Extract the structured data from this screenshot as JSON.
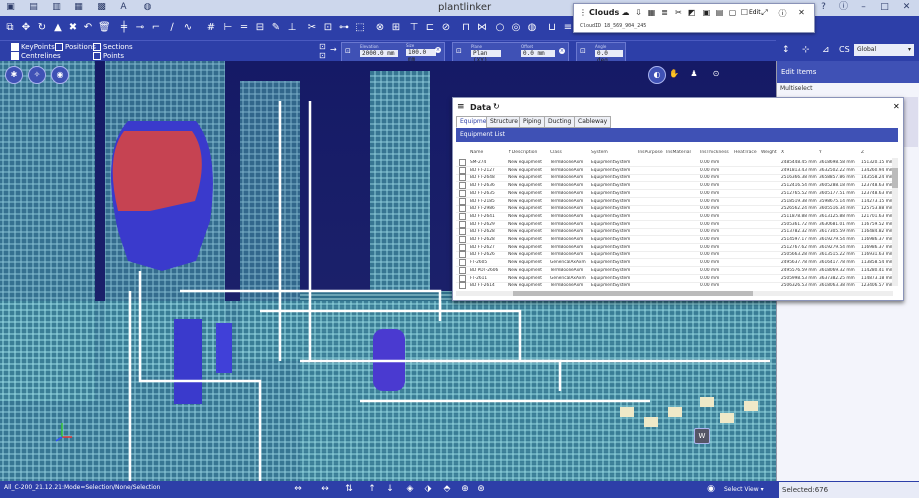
{
  "app": {
    "title": "plantlinker"
  },
  "toggles": [
    {
      "label": "KeyPoints",
      "checked": true
    },
    {
      "label": "Centrelines",
      "checked": true
    },
    {
      "label": "Positions",
      "checked": false
    },
    {
      "label": "Sections",
      "checked": false
    },
    {
      "label": "Points",
      "checked": false
    }
  ],
  "params": [
    {
      "label": "Elevation",
      "value": "2000.0 mm"
    },
    {
      "label": "Size",
      "value": "100.0 mm"
    },
    {
      "label": "Plane",
      "value": "Plan (XY)"
    },
    {
      "label": "Offset",
      "value": "0.0 mm"
    },
    {
      "label": "Angle",
      "value": "0.0 deg"
    }
  ],
  "right_toolbar": {
    "coord_system": "Global"
  },
  "edit_panel": {
    "title": "Edit Items",
    "mode": "Multiselect"
  },
  "clouds": {
    "title": "Clouds",
    "edit_label": "Edit",
    "cloud_id": "CloudID  18_569_904_245"
  },
  "data_window": {
    "title": "Data",
    "tabs": [
      "Equipment",
      "Structure",
      "Piping",
      "Ducting",
      "Cableway"
    ],
    "list_title": "Equipment List",
    "columns": [
      "Name",
      "Description",
      "Class",
      "System",
      "InsPurpose",
      "InsMaterial",
      "InsThickness",
      "HeatTrace",
      "Weight",
      "X",
      "Y",
      "Z"
    ],
    "rows": [
      [
        "SM-274",
        "New equipment",
        "TermBoolieAxm",
        "EquipmentSystem",
        "",
        "",
        "0.00 mm",
        "",
        "",
        "2485448.45 mm",
        "3618698.58 mm",
        "151320.15 mm"
      ],
      [
        "BD FT-2127",
        "New equipment",
        "TermBoolieAxm",
        "EquipmentSystem",
        "",
        "",
        "0.00 mm",
        "",
        "",
        "2491813.43 mm",
        "3632502.22 mm",
        "134260.94 mm"
      ],
      [
        "BD FT-2648",
        "New equipment",
        "TermBoolieAxm",
        "EquipmentSystem",
        "",
        "",
        "0.00 mm",
        "",
        "",
        "2516366.38 mm",
        "3658857.86 mm",
        "143558.24 mm"
      ],
      [
        "BD FT-2636",
        "New equipment",
        "TermBoolieAxm",
        "EquipmentSystem",
        "",
        "",
        "0.00 mm",
        "",
        "",
        "2512416.54 mm",
        "3605288.18 mm",
        "123748.63 mm"
      ],
      [
        "BD FT-2635",
        "New equipment",
        "TermBoolieAxm",
        "EquipmentSystem",
        "",
        "",
        "0.00 mm",
        "",
        "",
        "2512765.52 mm",
        "3605177.51 mm",
        "123748.63 mm"
      ],
      [
        "BD FT-2185",
        "New equipment",
        "TermBoolieAxm",
        "EquipmentSystem",
        "",
        "",
        "0.00 mm",
        "",
        "",
        "2518519.38 mm",
        "3598675.14 mm",
        "114273.15 mm"
      ],
      [
        "BD FT-2986",
        "New equipment",
        "TermBoolieAxm",
        "EquipmentSystem",
        "",
        "",
        "0.00 mm",
        "",
        "",
        "2526562.24 mm",
        "3605516.34 mm",
        "125753.88 mm"
      ],
      [
        "BD FT-2641",
        "New equipment",
        "TermBoolieAxm",
        "EquipmentSystem",
        "",
        "",
        "0.00 mm",
        "",
        "",
        "2511878.88 mm",
        "3613125.88 mm",
        "121701.63 mm"
      ],
      [
        "BD FT-2629",
        "New equipment",
        "TermBoolieAxm",
        "EquipmentSystem",
        "",
        "",
        "0.00 mm",
        "",
        "",
        "2505361.72 mm",
        "3630681.01 mm",
        "116759.52 mm"
      ],
      [
        "BD FT-2628",
        "New equipment",
        "TermBoolieAxm",
        "EquipmentSystem",
        "",
        "",
        "0.00 mm",
        "",
        "",
        "2513782.32 mm",
        "3617305.59 mm",
        "116484.82 mm"
      ],
      [
        "BD FT-2628",
        "New equipment",
        "TermBoolieAxm",
        "EquipmentSystem",
        "",
        "",
        "0.00 mm",
        "",
        "",
        "2514597.17 mm",
        "3619279.54 mm",
        "116986.37 mm"
      ],
      [
        "BD FT-2627",
        "New equipment",
        "TermBoolieAxm",
        "EquipmentSystem",
        "",
        "",
        "0.00 mm",
        "",
        "",
        "2512767.62 mm",
        "3619279.54 mm",
        "116986.37 mm"
      ],
      [
        "BD FT-2626",
        "New equipment",
        "TermBoolieAxm",
        "EquipmentSystem",
        "",
        "",
        "0.00 mm",
        "",
        "",
        "2505663.28 mm",
        "3613515.22 mm",
        "116931.63 mm"
      ],
      [
        "FT-2605",
        "New equipment",
        "GenericalAxAxm",
        "EquipmentSystem",
        "",
        "",
        "0.00 mm",
        "",
        "",
        "2495637.78 mm",
        "3616417.78 mm",
        "113858.54 mm"
      ],
      [
        "BD PDT-2606",
        "New equipment",
        "TermBoolieAxm",
        "EquipmentSystem",
        "",
        "",
        "0.00 mm",
        "",
        "",
        "2495576.59 mm",
        "3618069.32 mm",
        "114280.41 mm"
      ],
      [
        "FT-2611",
        "New equipment",
        "GenericalAxAxm",
        "EquipmentSystem",
        "",
        "",
        "0.00 mm",
        "",
        "",
        "2505998.53 mm",
        "3637382.25 mm",
        "114873.18 mm"
      ],
      [
        "BD FT-2614",
        "New equipment",
        "TermBoolieAxm",
        "EquipmentSystem",
        "",
        "",
        "0.00 mm",
        "",
        "",
        "2506326.53 mm",
        "3618063.38 mm",
        "123406.57 mm"
      ]
    ]
  },
  "status": {
    "path": "All_C-200_21.12.21:Mode=Selection/None/Selection",
    "select_view": "Select View",
    "selected": "Selected:676"
  }
}
